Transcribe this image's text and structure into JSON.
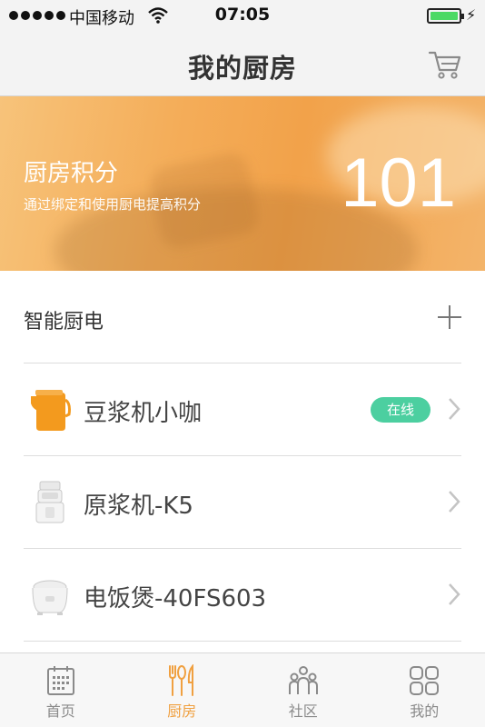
{
  "status_bar": {
    "carrier": "中国移动",
    "time": "07:05"
  },
  "nav": {
    "title": "我的厨房"
  },
  "banner": {
    "title": "厨房积分",
    "subtitle": "通过绑定和使用厨电提高积分",
    "score": "101"
  },
  "section": {
    "title": "智能厨电"
  },
  "devices": [
    {
      "name": "豆浆机小咖",
      "status": "在线",
      "icon": "soymilk-maker-icon"
    },
    {
      "name": "原浆机-K5",
      "status": "",
      "icon": "juicer-icon"
    },
    {
      "name": "电饭煲-40FS603",
      "status": "",
      "icon": "rice-cooker-icon"
    }
  ],
  "tabs": [
    {
      "label": "首页",
      "icon": "calendar-icon",
      "active": false
    },
    {
      "label": "厨房",
      "icon": "utensils-icon",
      "active": true
    },
    {
      "label": "社区",
      "icon": "community-icon",
      "active": false
    },
    {
      "label": "我的",
      "icon": "grid-icon",
      "active": false
    }
  ],
  "colors": {
    "accent": "#f0a040",
    "online_badge": "#4ccfa0",
    "banner": "#f2a24a"
  }
}
